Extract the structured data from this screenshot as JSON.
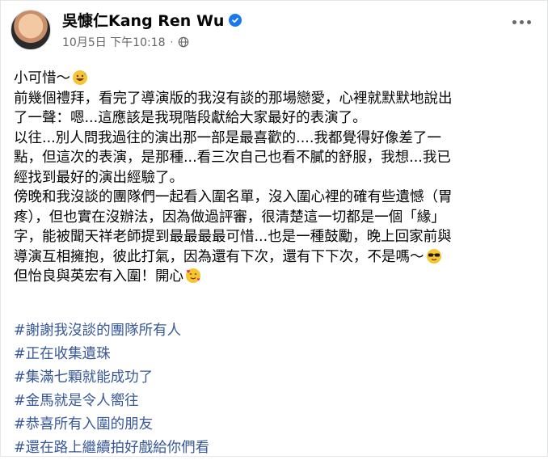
{
  "author": {
    "name": "吳慷仁Kang Ren Wu"
  },
  "meta": {
    "timestamp": "10月5日 下午10:18",
    "separator": "·"
  },
  "body": {
    "lines": [
      "小可惜～",
      "前幾個禮拜，看完了導演版的我沒有談的那場戀愛，心裡就默默地說出",
      "了一聲：嗯...這應該是我現階段獻給大家最好的表演了。",
      "以往...別人問我過往的演出那一部是最喜歡的....我都覺得好像差了一",
      "點，但這次的表演，是那種...看三次自己也看不膩的舒服，我想...我已",
      "經找到最好的演出經驗了。",
      "傍晚和我沒談的團隊們一起看入圍名單，沒入圍心裡的確有些遺憾（胃",
      "疼），但也實在沒辦法，因為做過評審，很清楚這一切都是一個「緣」",
      "字，能被聞天祥老師提到最最最最可惜...也是一種鼓勵，晚上回家前與",
      "導演互相擁抱，彼此打氣，因為還有下次，還有下下次，不是嗎～",
      "但怡良與英宏有入圍！開心"
    ]
  },
  "hashtags": [
    "#謝謝我沒談的團隊所有人",
    "#正在收集遺珠",
    "#集滿七顆就能成功了",
    "#金馬就是令人嚮往",
    "#恭喜所有入圍的朋友",
    "#還在路上繼續拍好戲給你們看"
  ],
  "icons": {
    "verified": "verified-badge-icon",
    "privacy": "globe-icon",
    "more": "more-options-icon",
    "emoji_1": "grinning-sweat-emoji",
    "emoji_2": "sunglasses-emoji",
    "emoji_3": "smiling-hearts-emoji"
  },
  "colors": {
    "accent": "#1877f2",
    "hashtag": "#385898",
    "muted": "#65676b"
  }
}
